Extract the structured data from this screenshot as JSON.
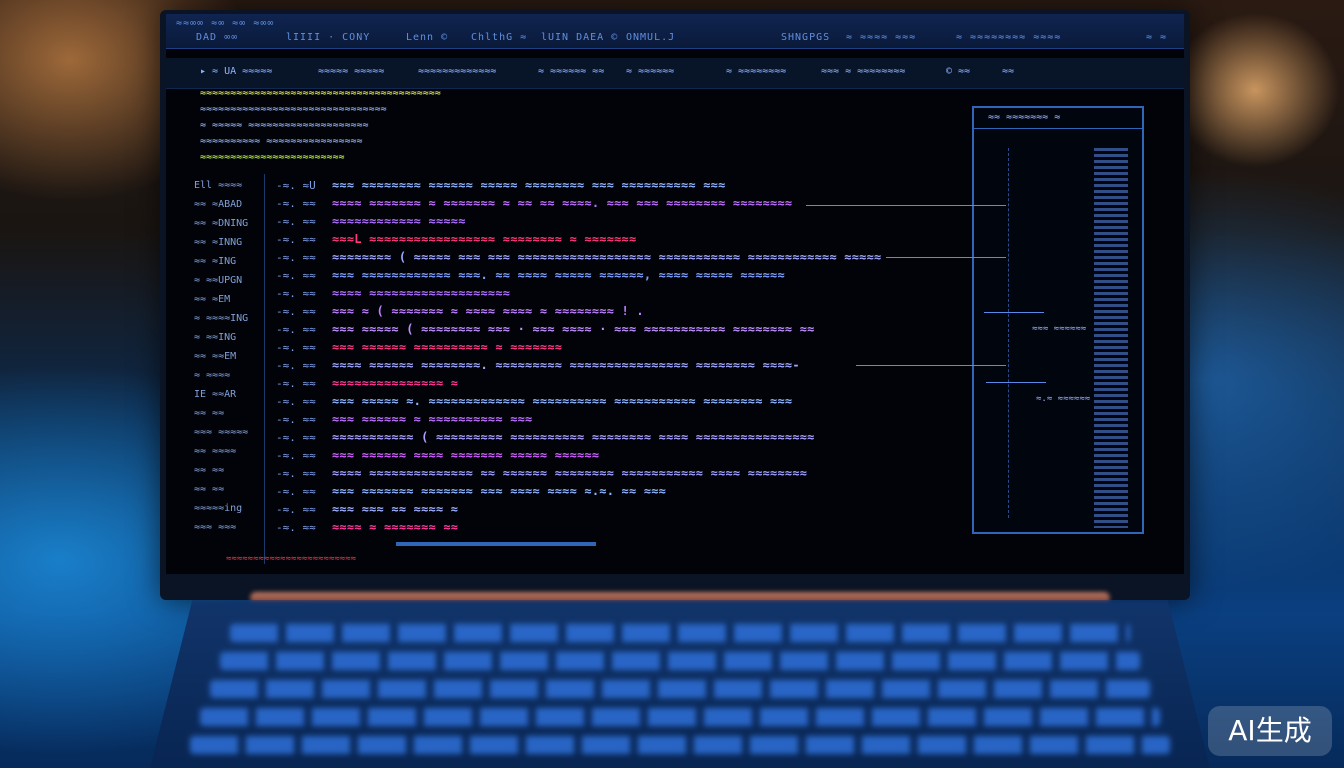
{
  "menubar": {
    "left_items": [
      "≈≈∞∞ ≈∞ ≈∞ ≈∞∞",
      "DAD ∞∞",
      "lIIII · CONY"
    ],
    "middle_items": [
      "Lenn ©",
      "ChlthG ≈",
      "lUIN DAEA ©",
      "ONMUL.J"
    ],
    "right_items": [
      "SHNGPGS",
      "≈ ≈≈≈≈ ≈≈≈",
      "≈ ≈≈≈≈≈≈≈≈ ≈≈≈≈",
      "≈ ≈"
    ]
  },
  "toolbar": {
    "items": [
      "▸ ≈ UA ≈≈≈≈≈",
      "≈≈≈≈≈ ≈≈≈≈≈",
      "≈≈≈≈≈≈≈≈≈≈≈≈≈",
      "≈ ≈≈≈≈≈≈ ≈≈",
      "≈ ≈≈≈≈≈≈",
      "≈ ≈≈≈≈≈≈≈≈",
      "≈≈≈ ≈ ≈≈≈≈≈≈≈≈",
      "© ≈≈",
      "≈≈"
    ]
  },
  "top_block": {
    "lines": [
      {
        "text": "≈≈≈≈≈≈≈≈≈≈≈≈≈≈≈≈≈≈≈≈≈≈≈≈≈≈≈≈≈≈≈≈≈≈≈≈≈≈≈≈",
        "color": "#e8ff70"
      },
      {
        "text": "≈≈≈≈≈≈≈≈≈≈≈≈≈≈≈≈≈≈≈≈≈≈≈≈≈≈≈≈≈≈≈",
        "color": "#9fc0ff"
      },
      {
        "text": "≈ ≈≈≈≈≈ ≈≈≈≈≈≈≈≈≈≈≈≈≈≈≈≈≈≈≈≈",
        "color": "#9fc0ff"
      },
      {
        "text": "≈≈≈≈≈≈≈≈≈≈ ≈≈≈≈≈≈≈≈≈≈≈≈≈≈≈≈",
        "color": "#9fc0ff"
      },
      {
        "text": "≈≈≈≈≈≈≈≈≈≈≈≈≈≈≈≈≈≈≈≈≈≈≈≈",
        "color": "#c9ff60"
      }
    ]
  },
  "gutter": {
    "items": [
      "Ell ≈≈≈≈",
      "≈≈ ≈ABAD",
      "≈≈ ≈DNING",
      "≈≈ ≈INNG",
      "≈≈ ≈ING",
      "≈ ≈≈UPGN",
      "≈≈ ≈EM",
      "≈ ≈≈≈≈ING",
      "≈ ≈≈ING",
      "≈≈ ≈≈EM",
      "≈ ≈≈≈≈",
      "IE ≈≈AR",
      "≈≈ ≈≈",
      "≈≈≈ ≈≈≈≈≈",
      "≈≈ ≈≈≈≈",
      "≈≈ ≈≈",
      "≈≈ ≈≈",
      "≈≈≈≈≈ing",
      "≈≈≈ ≈≈≈"
    ]
  },
  "code": {
    "lines": [
      {
        "num": "-≈. ≈U",
        "text": "≈≈≈ ≈≈≈≈≈≈≈≈ ≈≈≈≈≈≈ ≈≈≈≈≈ ≈≈≈≈≈≈≈≈ ≈≈≈ ≈≈≈≈≈≈≈≈≈≈ ≈≈≈",
        "color": "#8fb4ff"
      },
      {
        "num": "-≈. ≈≈",
        "text": "≈≈≈≈ ≈≈≈≈≈≈≈ ≈ ≈≈≈≈≈≈≈ ≈ ≈≈ ≈≈ ≈≈≈≈. ≈≈≈ ≈≈≈ ≈≈≈≈≈≈≈≈ ≈≈≈≈≈≈≈≈",
        "color": "#c070ff"
      },
      {
        "num": "-≈. ≈≈",
        "text": "≈≈≈≈≈≈≈≈≈≈≈≈ ≈≈≈≈≈",
        "color": "#b070ff"
      },
      {
        "num": "-≈. ≈≈",
        "text": "≈≈≈L ≈≈≈≈≈≈≈≈≈≈≈≈≈≈≈≈≈ ≈≈≈≈≈≈≈≈ ≈ ≈≈≈≈≈≈≈",
        "color": "#ff3a7a"
      },
      {
        "num": "-≈. ≈≈",
        "text": "≈≈≈≈≈≈≈≈ ( ≈≈≈≈≈ ≈≈≈ ≈≈≈ ≈≈≈≈≈≈≈≈≈≈≈≈≈≈≈≈≈≈ ≈≈≈≈≈≈≈≈≈≈≈ ≈≈≈≈≈≈≈≈≈≈≈≈ ≈≈≈≈≈",
        "color": "#9fa8ff"
      },
      {
        "num": "-≈. ≈≈",
        "text": "≈≈≈ ≈≈≈≈≈≈≈≈≈≈≈≈ ≈≈≈. ≈≈ ≈≈≈≈ ≈≈≈≈≈ ≈≈≈≈≈≈, ≈≈≈≈ ≈≈≈≈≈ ≈≈≈≈≈≈",
        "color": "#7fa0ff"
      },
      {
        "num": "-≈. ≈≈",
        "text": "≈≈≈≈ ≈≈≈≈≈≈≈≈≈≈≈≈≈≈≈≈≈≈≈",
        "color": "#b070ff"
      },
      {
        "num": "-≈. ≈≈",
        "text": "≈≈≈ ≈ ( ≈≈≈≈≈≈≈ ≈ ≈≈≈≈ ≈≈≈≈ ≈ ≈≈≈≈≈≈≈≈ ! .",
        "color": "#c080ff"
      },
      {
        "num": "-≈. ≈≈",
        "text": "≈≈≈ ≈≈≈≈≈ ( ≈≈≈≈≈≈≈≈ ≈≈≈ · ≈≈≈ ≈≈≈≈ · ≈≈≈ ≈≈≈≈≈≈≈≈≈≈≈ ≈≈≈≈≈≈≈≈ ≈≈",
        "color": "#c090ff"
      },
      {
        "num": "-≈. ≈≈",
        "text": "≈≈≈ ≈≈≈≈≈≈ ≈≈≈≈≈≈≈≈≈≈ ≈ ≈≈≈≈≈≈≈",
        "color": "#ff3a8a"
      },
      {
        "num": "-≈. ≈≈",
        "text": "≈≈≈≈ ≈≈≈≈≈≈ ≈≈≈≈≈≈≈≈. ≈≈≈≈≈≈≈≈≈ ≈≈≈≈≈≈≈≈≈≈≈≈≈≈≈≈ ≈≈≈≈≈≈≈≈ ≈≈≈≈-",
        "color": "#a0a8ff"
      },
      {
        "num": "-≈. ≈≈",
        "text": "≈≈≈≈≈≈≈≈≈≈≈≈≈≈≈ ≈",
        "color": "#ff3a9a"
      },
      {
        "num": "-≈. ≈≈",
        "text": "≈≈≈ ≈≈≈≈≈ ≈. ≈≈≈≈≈≈≈≈≈≈≈≈≈ ≈≈≈≈≈≈≈≈≈≈ ≈≈≈≈≈≈≈≈≈≈≈ ≈≈≈≈≈≈≈≈ ≈≈≈",
        "color": "#8fb4ff"
      },
      {
        "num": "-≈. ≈≈",
        "text": "≈≈≈ ≈≈≈≈≈≈ ≈ ≈≈≈≈≈≈≈≈≈≈ ≈≈≈",
        "color": "#c070ff"
      },
      {
        "num": "-≈. ≈≈",
        "text": "≈≈≈≈≈≈≈≈≈≈≈ ( ≈≈≈≈≈≈≈≈≈ ≈≈≈≈≈≈≈≈≈≈ ≈≈≈≈≈≈≈≈ ≈≈≈≈ ≈≈≈≈≈≈≈≈≈≈≈≈≈≈≈≈",
        "color": "#a8a0ff"
      },
      {
        "num": "-≈. ≈≈",
        "text": "≈≈≈ ≈≈≈≈≈≈ ≈≈≈≈ ≈≈≈≈≈≈≈ ≈≈≈≈≈ ≈≈≈≈≈≈",
        "color": "#d060ff"
      },
      {
        "num": "-≈. ≈≈",
        "text": "≈≈≈≈ ≈≈≈≈≈≈≈≈≈≈≈≈≈≈ ≈≈ ≈≈≈≈≈≈ ≈≈≈≈≈≈≈≈ ≈≈≈≈≈≈≈≈≈≈≈ ≈≈≈≈ ≈≈≈≈≈≈≈≈",
        "color": "#9fa0ff"
      },
      {
        "num": "-≈. ≈≈",
        "text": "≈≈≈ ≈≈≈≈≈≈≈ ≈≈≈≈≈≈≈ ≈≈≈ ≈≈≈≈ ≈≈≈≈ ≈.≈. ≈≈ ≈≈≈",
        "color": "#8fb4ff"
      },
      {
        "num": "-≈. ≈≈",
        "text": "≈≈≈ ≈≈≈ ≈≈ ≈≈≈≈ ≈",
        "color": "#a0b0ff"
      },
      {
        "num": "-≈. ≈≈",
        "text": "≈≈≈≈ ≈ ≈≈≈≈≈≈≈ ≈≈",
        "color": "#ff3aa0"
      }
    ]
  },
  "side_panel": {
    "header": "≈≈ ≈≈≈≈≈≈≈ ≈",
    "label_a": "≈≈≈ ≈≈≈≈≈≈",
    "label_b": "≈.≈ ≈≈≈≈≈≈"
  },
  "status_line": "≈≈≈≈≈≈≈≈≈≈≈≈≈≈≈≈≈≈≈≈≈≈≈≈",
  "watermark": "AI生成"
}
